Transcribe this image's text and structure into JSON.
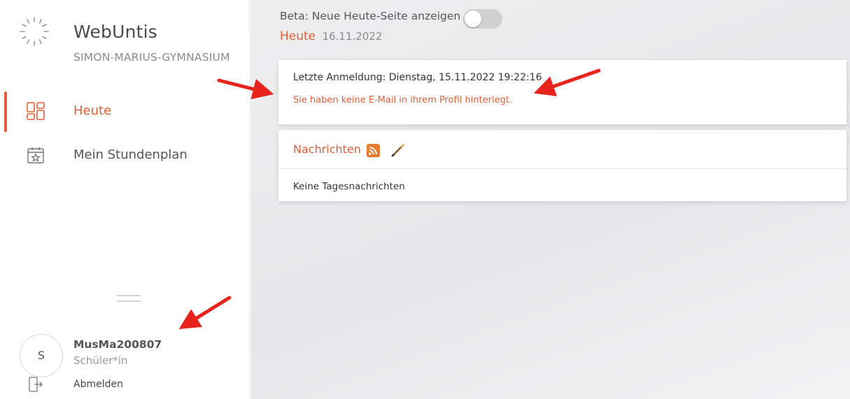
{
  "app": {
    "title": "WebUntis",
    "school": "SIMON-MARIUS-GYMNASIUM",
    "accent_color": "#e0603a"
  },
  "sidebar": {
    "items": [
      {
        "label": "Heute",
        "icon": "dashboard-grid-icon",
        "active": true
      },
      {
        "label": "Mein Stundenplan",
        "icon": "calendar-star-icon",
        "active": false
      }
    ]
  },
  "user": {
    "initial": "S",
    "username": "MusMa200807",
    "role": "Schüler*in",
    "logout_label": "Abmelden"
  },
  "header": {
    "beta_label": "Beta: Neue Heute-Seite anzeigen",
    "beta_enabled": false,
    "page_title": "Heute",
    "date": "16.11.2022"
  },
  "login_card": {
    "last_login": "Letzte Anmeldung: Dienstag, 15.11.2022 19:22:16",
    "warning": "Sie haben keine E-Mail in ihrem Profil hinterlegt."
  },
  "news_card": {
    "title": "Nachrichten",
    "rss_icon": "rss-feed-icon",
    "edit_icon": "pencil-icon",
    "empty_text": "Keine Tagesnachrichten"
  },
  "annotations": {
    "arrow_color": "#e8231b"
  }
}
